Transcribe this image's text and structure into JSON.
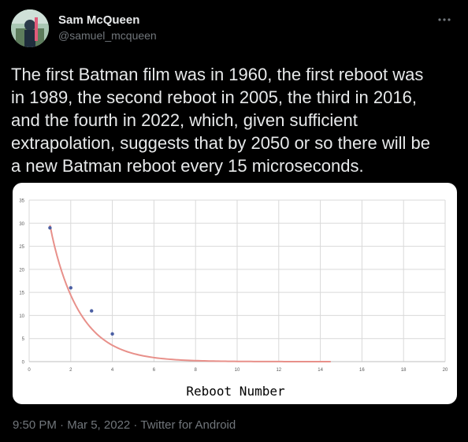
{
  "user": {
    "display_name": "Sam McQueen",
    "handle": "@samuel_mcqueen"
  },
  "more_icon": "more-horizontal-icon",
  "tweet_text": "The first Batman film was in 1960, the first reboot was\nin 1989, the second reboot in 2005, the third in 2016,\nand the fourth in 2022, which, given sufficient\nextrapolation, suggests that by 2050 or so there will be\na new Batman reboot every 15 microseconds.",
  "chart_data": {
    "type": "scatter",
    "xlabel": "Reboot Number",
    "ylabel": "",
    "xlim": [
      0,
      20
    ],
    "ylim": [
      0,
      35
    ],
    "x_ticks": [
      0,
      2,
      4,
      6,
      8,
      10,
      12,
      14,
      16,
      18,
      20
    ],
    "y_ticks": [
      0,
      5,
      10,
      15,
      20,
      25,
      30,
      35
    ],
    "grid": true,
    "points": [
      {
        "x": 1,
        "y": 29
      },
      {
        "x": 2,
        "y": 16
      },
      {
        "x": 3,
        "y": 11
      },
      {
        "x": 4,
        "y": 6
      }
    ],
    "trendline": {
      "color": "#e8908a",
      "x_range": [
        1,
        14.5
      ],
      "coeffs": [
        29,
        -0.7
      ]
    },
    "point_color": "#4b5fa3"
  },
  "footer": {
    "time": "9:50 PM",
    "separator": " · ",
    "date": "Mar 5, 2022",
    "source": "Twitter for Android"
  }
}
